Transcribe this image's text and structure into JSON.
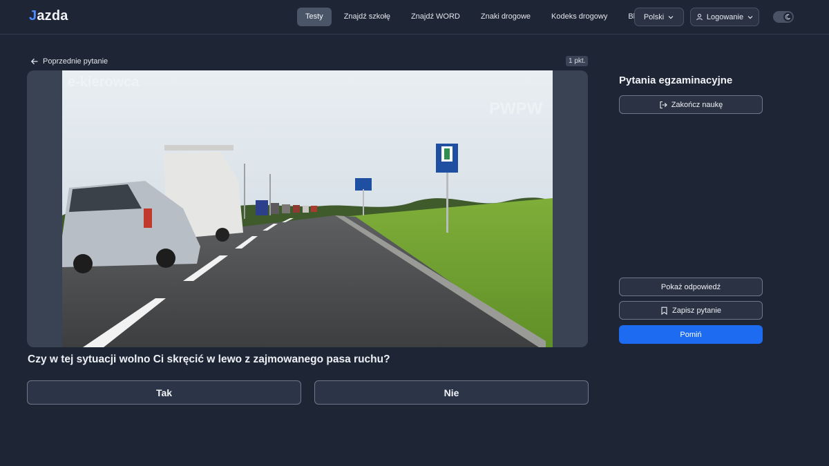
{
  "header": {
    "logo_prefix": "J",
    "logo_rest": "azda",
    "nav": [
      {
        "label": "Testy",
        "active": true
      },
      {
        "label": "Znajdź szkołę",
        "active": false
      },
      {
        "label": "Znajdź WORD",
        "active": false
      },
      {
        "label": "Znaki drogowe",
        "active": false
      },
      {
        "label": "Kodeks drogowy",
        "active": false
      },
      {
        "label": "Blog",
        "active": false
      }
    ],
    "language_label": "Polski",
    "login_label": "Logowanie",
    "theme_toggle_icon": "moon-icon"
  },
  "question": {
    "prev_label": "Poprzednie pytanie",
    "points_label": "1 pkt.",
    "text": "Czy w tej sytuacji wolno Ci skręcić w lewo z zajmowanego pasa ruchu?",
    "answers": [
      "Tak",
      "Nie"
    ],
    "media_watermark_left": "e-kierowca",
    "media_watermark_right": "PWPW"
  },
  "sidebar": {
    "title": "Pytania egzaminacyjne",
    "end_label": "Zakończ naukę",
    "show_answer_label": "Pokaż odpowiedź",
    "save_label": "Zapisz pytanie",
    "skip_label": "Pomiń"
  },
  "colors": {
    "background": "#1e2535",
    "accent": "#1d6bf0",
    "nav_active": "#4b5568"
  }
}
